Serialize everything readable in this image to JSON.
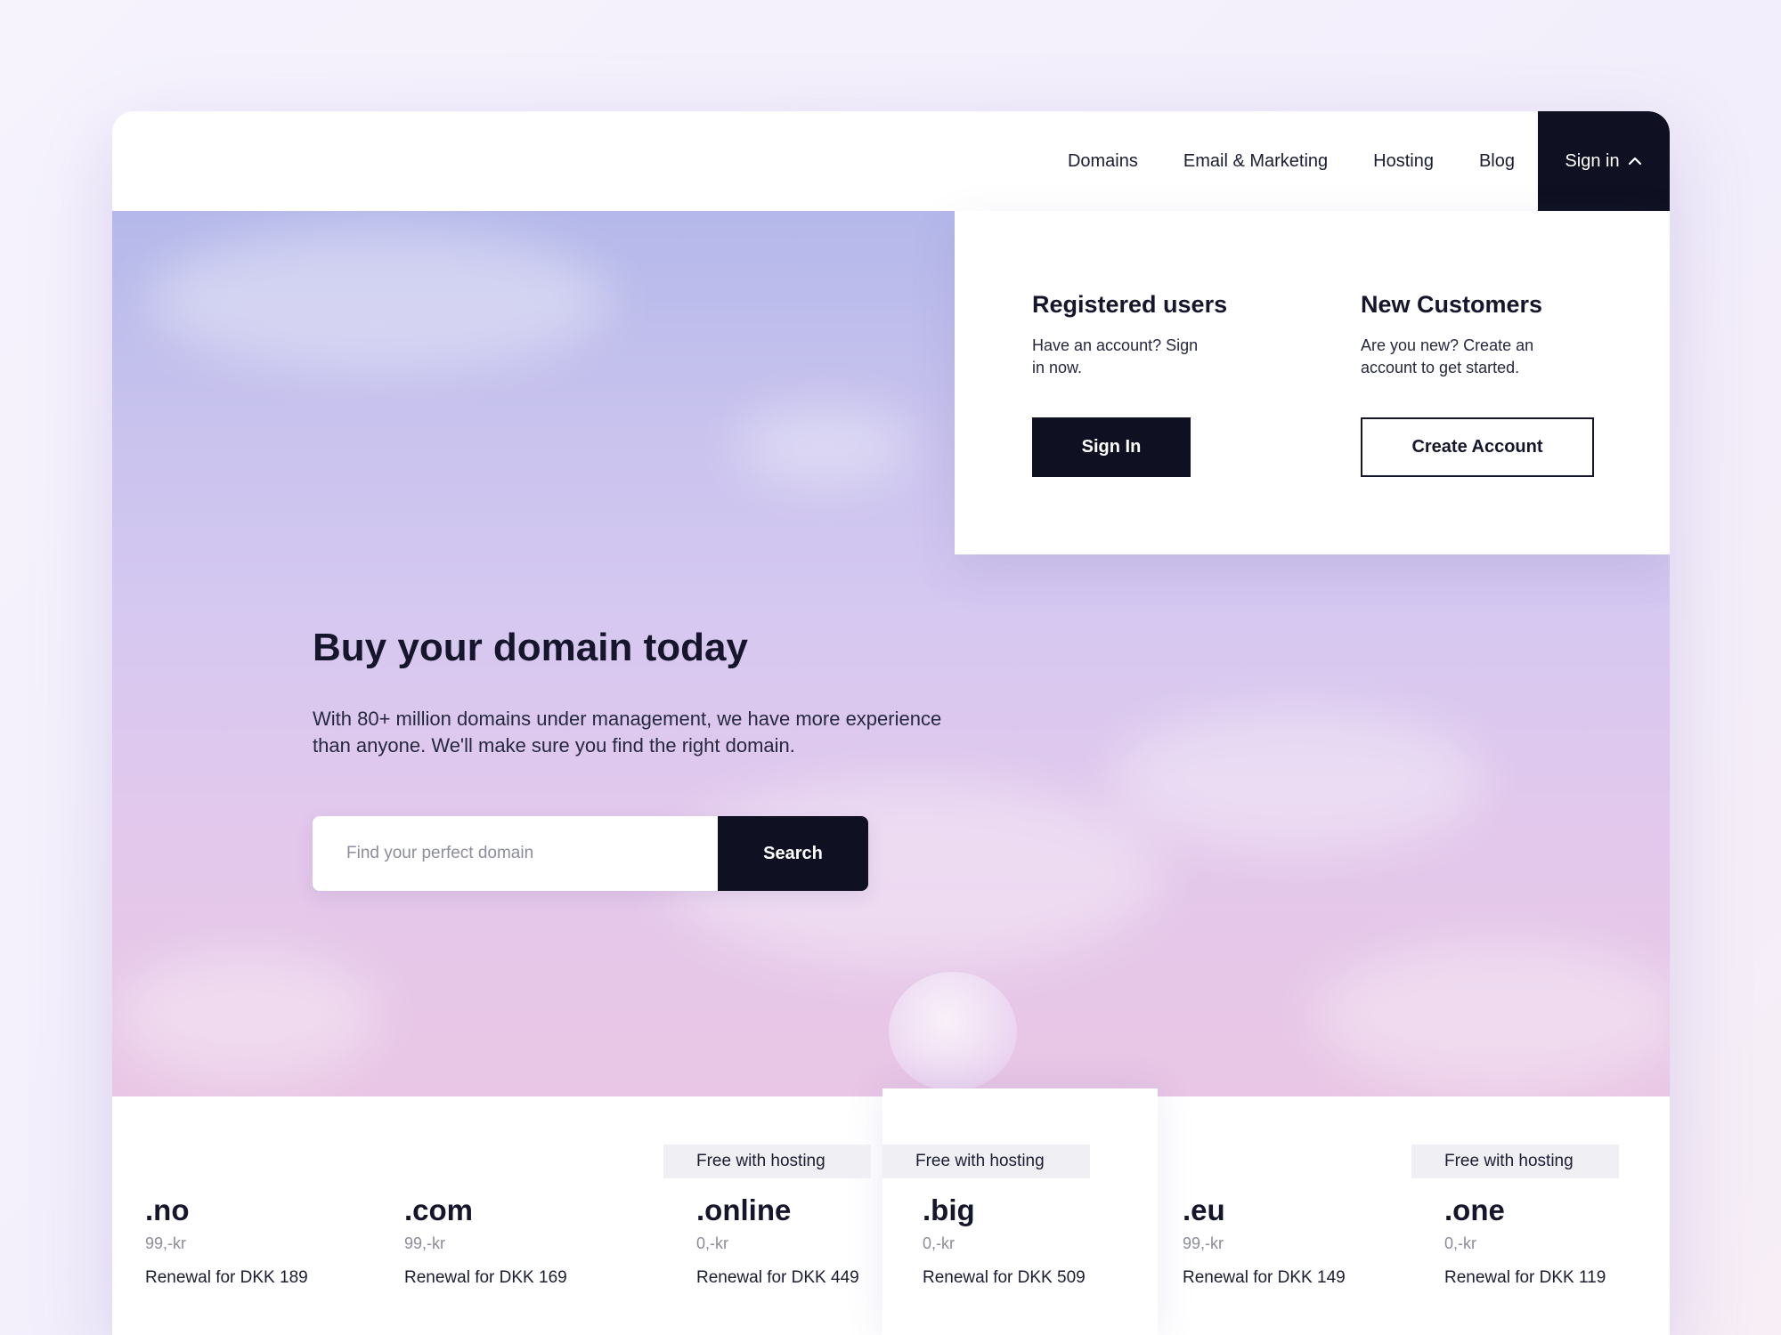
{
  "nav": {
    "links": [
      "Domains",
      "Email & Marketing",
      "Hosting",
      "Blog"
    ],
    "signin_label": "Sign in"
  },
  "hero": {
    "title": "Buy your domain today",
    "description": "With 80+ million domains under management, we have more experience than anyone. We'll make sure you find the right domain.",
    "search_placeholder": "Find your perfect domain",
    "search_button": "Search"
  },
  "dropdown": {
    "registered": {
      "title": "Registered users",
      "text": "Have an account? Sign in now.",
      "button": "Sign In"
    },
    "new_customers": {
      "title": "New Customers",
      "text": "Are you new? Create an account to get started.",
      "button": "Create Account"
    }
  },
  "domains": [
    {
      "tld": ".no",
      "price": "99,-kr",
      "renewal": "Renewal for DKK 189",
      "badge": ""
    },
    {
      "tld": ".com",
      "price": "99,-kr",
      "renewal": "Renewal for DKK 169",
      "badge": ""
    },
    {
      "tld": ".online",
      "price": "0,-kr",
      "renewal": "Renewal for DKK 449",
      "badge": "Free with hosting"
    },
    {
      "tld": ".big",
      "price": "0,-kr",
      "renewal": "Renewal for DKK 509",
      "badge": "Free with hosting"
    },
    {
      "tld": ".eu",
      "price": "99,-kr",
      "renewal": "Renewal for DKK 149",
      "badge": ""
    },
    {
      "tld": ".one",
      "price": "0,-kr",
      "renewal": "Renewal for DKK 119",
      "badge": "Free with hosting"
    }
  ],
  "colors": {
    "primary_dark": "#0f1122",
    "badge_bg": "#efeff4",
    "muted_text": "#8b8c99"
  }
}
